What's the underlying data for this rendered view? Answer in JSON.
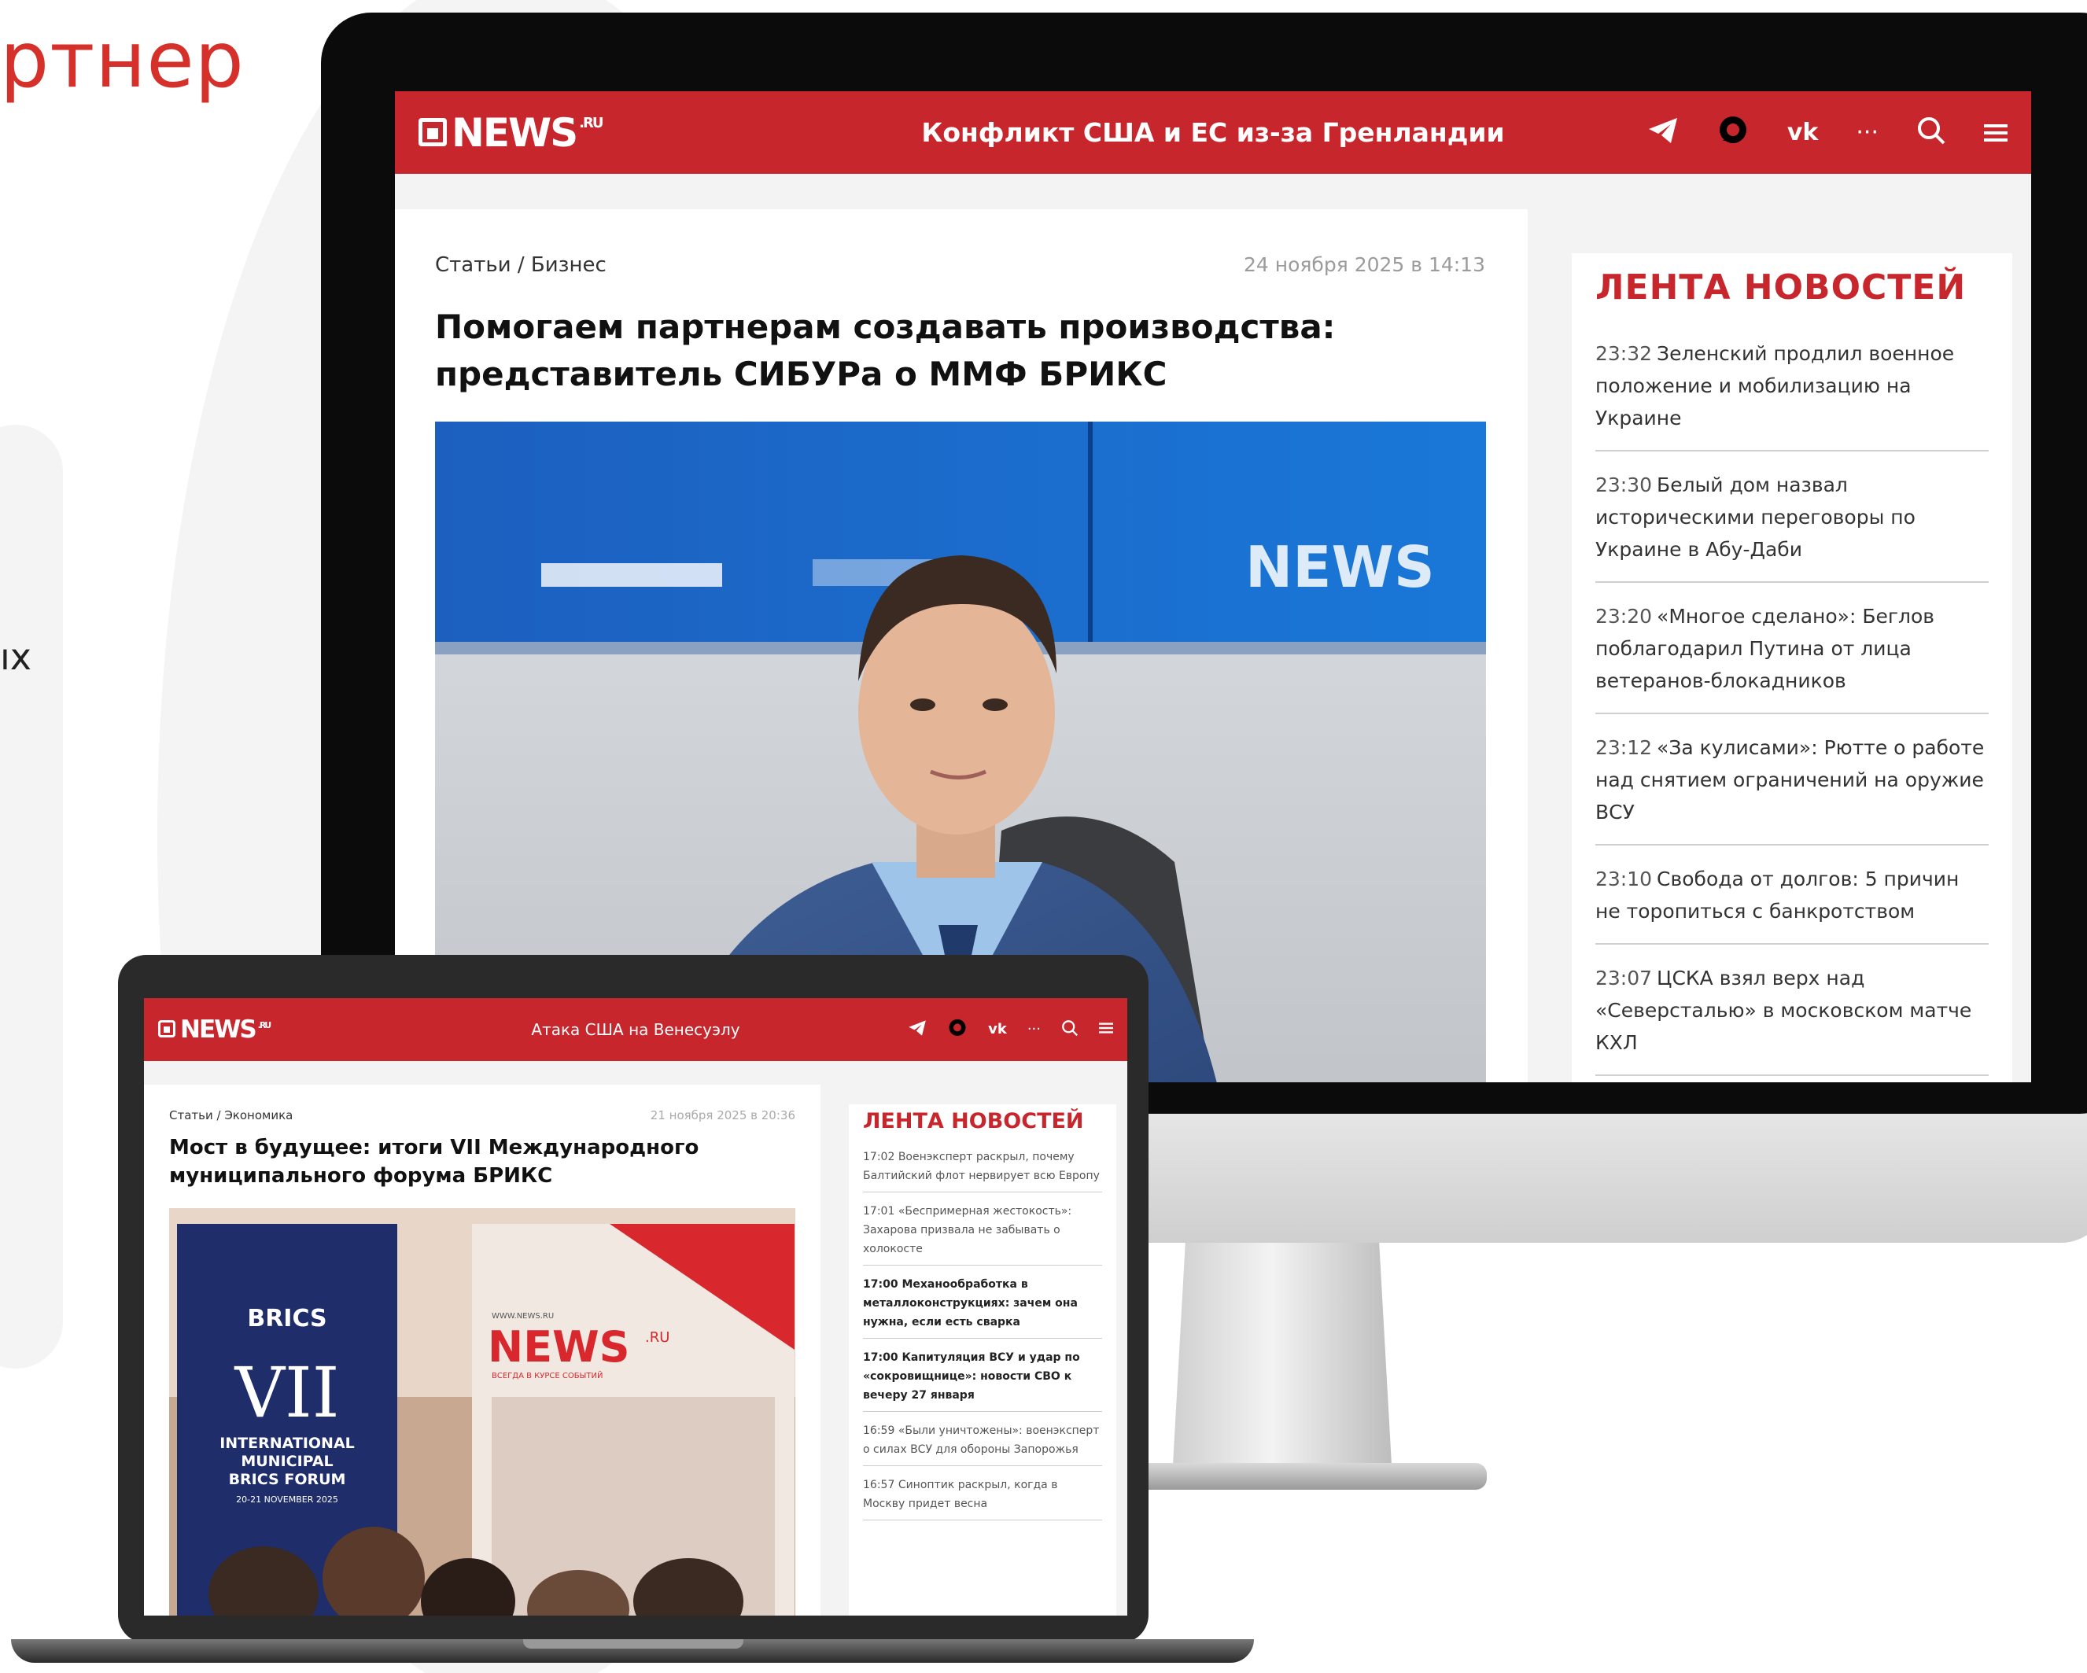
{
  "backdrop": {
    "brand_fragment": "ртнер",
    "side_fragment": "ıх"
  },
  "colors": {
    "accent": "#c7262c"
  },
  "monitor": {
    "header": {
      "logo": "NEWS",
      "logo_suffix": ".RU",
      "topic": "Конфликт США и ЕС из-за Гренландии",
      "icons": [
        "telegram-icon",
        "max-icon",
        "vk-icon",
        "more-icon",
        "search-icon",
        "menu-icon"
      ]
    },
    "article": {
      "breadcrumb": "Статьи / Бизнес",
      "date": "24 ноября 2025 в 14:13",
      "headline": "Помогаем партнерам создавать производства: представитель СИБУРа о ММФ БРИКС",
      "photo_backdrop_logo": "NEWS"
    },
    "feed": {
      "title": "ЛЕНТА НОВОСТЕЙ",
      "items": [
        {
          "time": "23:32",
          "text": "Зеленский продлил военное положение и мобилизацию на Украине"
        },
        {
          "time": "23:30",
          "text": "Белый дом назвал историческими переговоры по Украине в Абу-Даби"
        },
        {
          "time": "23:20",
          "text": "«Многое сделано»: Беглов поблагодарил Путина от лица ветеранов-блокадников"
        },
        {
          "time": "23:12",
          "text": "«За кулисами»: Рютте о работе над снятием ограничений на оружие ВСУ"
        },
        {
          "time": "23:10",
          "text": "Свобода от долгов: 5 причин не торопиться с банкротством"
        },
        {
          "time": "23:07",
          "text": "ЦСКА взял верх над «Северсталью» в московском матче КХЛ"
        }
      ]
    }
  },
  "laptop": {
    "header": {
      "logo": "NEWS",
      "logo_suffix": ".RU",
      "topic": "Атака США на Венесуэлу"
    },
    "article": {
      "breadcrumb": "Статьи / Экономика",
      "date": "21 ноября 2025 в 20:36",
      "headline": "Мост в будущее: итоги VII Международного муниципального форума БРИКС",
      "poster_left": {
        "brics": "BRICS",
        "numeral": "VII",
        "forum_line1": "INTERNATIONAL",
        "forum_line2": "MUNICIPAL",
        "forum_line3": "BRICS FORUM",
        "dates": "20-21 NOVEMBER 2025"
      },
      "poster_right": {
        "url": "WWW.NEWS.RU",
        "logo": "NEWS",
        "logo_suffix": ".RU",
        "tagline": "ВСЕГДА В КУРСЕ СОБЫТИЙ"
      }
    },
    "feed": {
      "title": "ЛЕНТА НОВОСТЕЙ",
      "items": [
        {
          "time": "17:02",
          "text": "Военэксперт раскрыл, почему Балтийский флот нервирует всю Европу"
        },
        {
          "time": "17:01",
          "text": "«Беспримерная жестокость»: Захарова призвала не забывать о холокосте"
        },
        {
          "time": "17:00",
          "text": "Механообработка в металлоконструкциях: зачем она нужна, если есть сварка"
        },
        {
          "time": "17:00",
          "text": "Капитуляция ВСУ и удар по «сокровищнице»: новости СВО к вечеру 27 января"
        },
        {
          "time": "16:59",
          "text": "«Были уничтожены»: военэксперт о силах ВСУ для обороны Запорожья"
        },
        {
          "time": "16:57",
          "text": "Синоптик раскрыл, когда в Москву придет весна"
        }
      ]
    }
  }
}
